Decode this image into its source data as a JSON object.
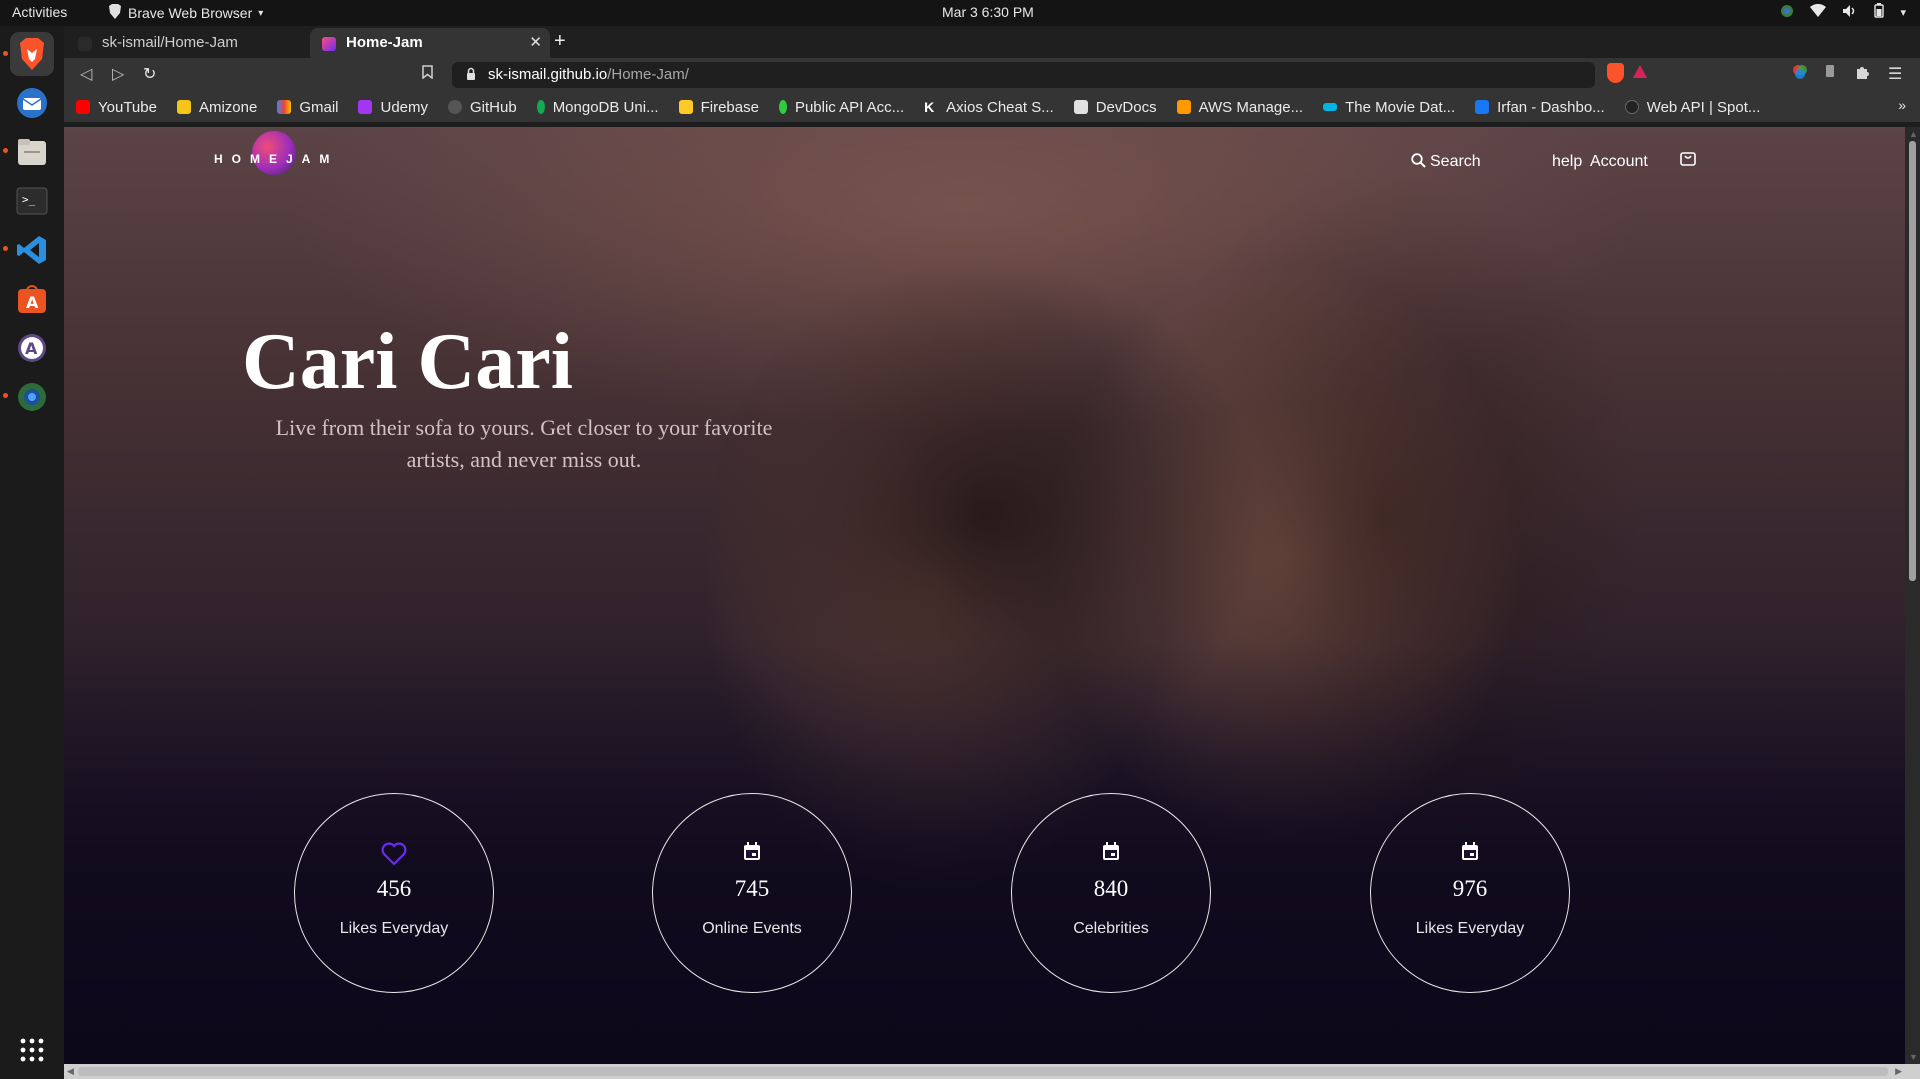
{
  "system": {
    "activities": "Activities",
    "app_menu": "Brave Web Browser",
    "clock": "Mar 3  6:30 PM"
  },
  "dock": {
    "items": [
      "brave-browser-icon",
      "thunderbird-icon",
      "files-icon",
      "terminal-icon",
      "vscode-icon",
      "software-center-icon",
      "software-updater-icon",
      "chrome-icon",
      "app-grid-icon"
    ]
  },
  "browser": {
    "tabs": [
      {
        "title": "sk-ismail/Home-Jam",
        "active": false
      },
      {
        "title": "Home-Jam",
        "active": true
      }
    ],
    "url_host": "sk-ismail.github.io",
    "url_path": "/Home-Jam/",
    "bookmarks": [
      {
        "label": "YouTube",
        "color": "#ff0000"
      },
      {
        "label": "Amizone",
        "color": "#f5c518"
      },
      {
        "label": "Gmail",
        "color": "#ea4335"
      },
      {
        "label": "Udemy",
        "color": "#a435f0"
      },
      {
        "label": "GitHub",
        "color": "#444444"
      },
      {
        "label": "MongoDB Uni...",
        "color": "#13aa52"
      },
      {
        "label": "Firebase",
        "color": "#ffca28"
      },
      {
        "label": "Public API Acc...",
        "color": "#2ecc40"
      },
      {
        "label": "Axios Cheat S...",
        "color": "#ffffff"
      },
      {
        "label": "DevDocs",
        "color": "#e0e0e0"
      },
      {
        "label": "AWS Manage...",
        "color": "#ff9900"
      },
      {
        "label": "The Movie Dat...",
        "color": "#01b4e4"
      },
      {
        "label": "Irfan - Dashbo...",
        "color": "#1877f2"
      },
      {
        "label": "Web API | Spot...",
        "color": "#222222"
      }
    ],
    "more": "»"
  },
  "page": {
    "logo_text": "HOMEJAM",
    "nav": {
      "search": "Search",
      "help": "help",
      "account": "Account"
    },
    "hero": {
      "title": "Cari Cari",
      "subtitle": "Live from their sofa to yours. Get closer to your favorite artists, and never miss out."
    },
    "stats": [
      {
        "icon": "heart-icon",
        "value": "456",
        "label": "Likes Everyday"
      },
      {
        "icon": "calendar-icon",
        "value": "745",
        "label": "Online Events"
      },
      {
        "icon": "calendar-icon",
        "value": "840",
        "label": "Celebrities"
      },
      {
        "icon": "calendar-icon",
        "value": "976",
        "label": "Likes Everyday"
      }
    ],
    "accent": "#6b2cf0"
  }
}
